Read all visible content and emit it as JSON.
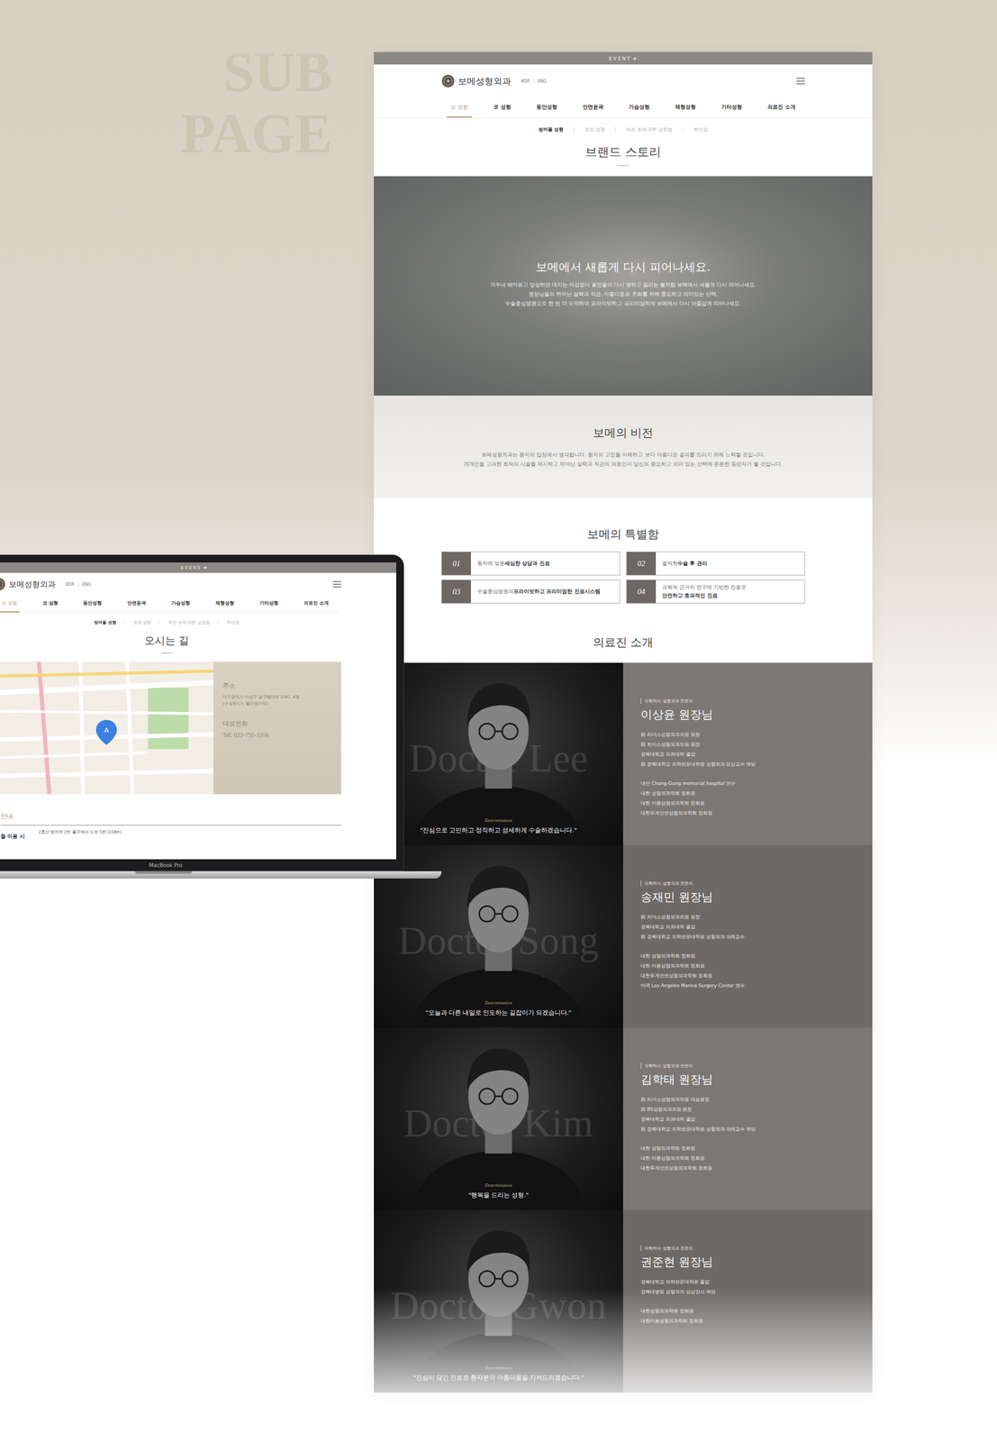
{
  "background": {
    "title_lines": [
      "SUB",
      "PAGE"
    ]
  },
  "site": {
    "event_label": "EVENT",
    "event_caret": "▾",
    "logo_name": "보메성형외과",
    "lang": [
      "KOR",
      "ENG"
    ],
    "lang_sep": "|"
  },
  "nav": [
    {
      "label": "눈 성형",
      "selected": true
    },
    {
      "label": "코 성형",
      "selected": false
    },
    {
      "label": "동안성형",
      "selected": false
    },
    {
      "label": "안면윤곽",
      "selected": false
    },
    {
      "label": "가슴성형",
      "selected": false
    },
    {
      "label": "체형성형",
      "selected": false
    },
    {
      "label": "기타성형",
      "selected": false
    },
    {
      "label": "의료진 소개",
      "selected": false
    }
  ],
  "subnav": [
    {
      "label": "쌍꺼풀 성형",
      "selected": true
    },
    {
      "label": "트임 성형",
      "selected": false
    },
    {
      "label": "처진 눈에 대한 교정법",
      "selected": false
    },
    {
      "label": "하안검",
      "selected": false
    }
  ],
  "brand": {
    "title": "브랜드 스토리",
    "hero_heading": "보메에서 새롭게 다시 피어나세요.",
    "hero_lines": [
      "겨우내 메마르고 앙상하던 대지는 어김없이 꽃망울이 다시 맺히고 열리는 봄처럼 보메에서 새롭게 다시 피어나세요.",
      "원장님들의 뛰어난 실력과 직관, 아름다움과 조화를 위해 중요하고 의미있는 선택,",
      "수술중심병원으로 한 번 더 도약하여 프라이빗하고 프리미엄하게 보메에서 다시 아름답게 피어나세요."
    ]
  },
  "vision": {
    "title": "보메의 비전",
    "lines": [
      "보메성형외과는 환자의 입장에서 생각합니다. 환자의 고민을 이해하고 보다 아름다운 결과를 드리기 위해 노력할 것입니다.",
      "개개인을 고려한 최적의 시술을 제시하고 뛰어난 실력과 직관의 의료인이 당신의 중요하고 의미 있는 선택에 든든한 동반자가 될 것입니다."
    ]
  },
  "special": {
    "title": "보메의 특별함",
    "items": [
      {
        "num": "01",
        "text": "환자에 맞춘 ",
        "bold": "세심한 상담과 진료"
      },
      {
        "num": "02",
        "text": "철저한 ",
        "bold": "수술 후 관리"
      },
      {
        "num": "03",
        "text": "수술중심병원의 ",
        "bold": "프라이빗하고 프리미엄한 진료시스템"
      },
      {
        "num": "04",
        "text": "과학적 근거와 연구에 기반한 진료로 ",
        "bold": "안전하고 효과적인 진료"
      }
    ]
  },
  "doctors": {
    "title": "의료진 소개",
    "items": [
      {
        "watermark": "Doctor Lee",
        "tagline": "Determination",
        "quote": "“진심으로 고민하고 정직하고 섬세하게 수술하겠습니다.”",
        "badge": "의학박사 성형외과 전문의",
        "name": "이상윤 원장님",
        "careers": [
          "前 리더스성형외과의원 원장",
          "前 토미스성형외과의원 원장",
          "경북대학교 의과대학 졸업",
          "前 경북대학교 의학전문대학원 성형외과 임상교수 역임"
        ],
        "memberships": [
          "대만 Chang-Gung memorial hospital 연수",
          "대한 성형외과학회 정회원",
          "대한 미용성형외과학회 정회원",
          "대한두개안면성형외과학회 정회원"
        ]
      },
      {
        "watermark": "Doctor Song",
        "tagline": "Determination",
        "quote": "“오늘과 다른 내일로 인도하는 길잡이가 되겠습니다.”",
        "badge": "의학박사 성형외과 전문의",
        "name": "송재민 원장님",
        "careers": [
          "前 리더스성형외과의원 원장",
          "경북대학교 의과대학 졸업",
          "前 경북대학교 의학전문대학원 성형외과 외래교수"
        ],
        "memberships": [
          "대한 성형외과학회 정회원",
          "대한 미용성형외과학회 정회원",
          "대한두개안면성형외과학회 정회원",
          "미국 Los Angeles Marina Surgery Center 연수"
        ]
      },
      {
        "watermark": "Doctor Kim",
        "tagline": "Determination",
        "quote": "“행복을 드리는 성형.”",
        "badge": "의학박사 성형외과 전문의",
        "name": "김학태 원장님",
        "careers": [
          "前 리더스성형외과의원 대표원장",
          "前 BS성형외과의원 원장",
          "경북대학교 의과대학 졸업",
          "前 경북대학교 의학전문대학원 성형외과 외래교수 역임"
        ],
        "memberships": [
          "대한 성형외과학회 정회원",
          "대한 미용성형외과학회 정회원",
          "대한두개안면성형외과학회 정회원"
        ]
      },
      {
        "watermark": "Doctor Gwon",
        "tagline": "Determination",
        "quote": "“진심이 담긴 진료로 환자분의 아름다움을 지켜드리겠습니다.”",
        "badge": "의학박사 성형외과 전문의",
        "name": "권준현 원장님",
        "careers": [
          "경북대학교 의학전문대학원 졸업",
          "경북대병원 성형외과 임상강사 역임"
        ],
        "memberships": [
          "대한성형외과학회 정회원",
          "대한미용성형외과학회 정회원"
        ]
      }
    ]
  },
  "laptop": {
    "label": "MacBook Pro",
    "title": "오시는 길",
    "map_pin": "A",
    "address_label": "주소",
    "address_lines": [
      "대구광역시 수성구 달구벌대로 2382, 8층",
      "(수성동3가, 벨리엠타워)"
    ],
    "phone_label": "대표전화",
    "phone": "Tel. 053-755-3356",
    "guide_title": "안내",
    "guide_label": "철 이용 시",
    "guide_text": "2호선 범어역 2번 출구에서 도보 5분 (218m)"
  }
}
